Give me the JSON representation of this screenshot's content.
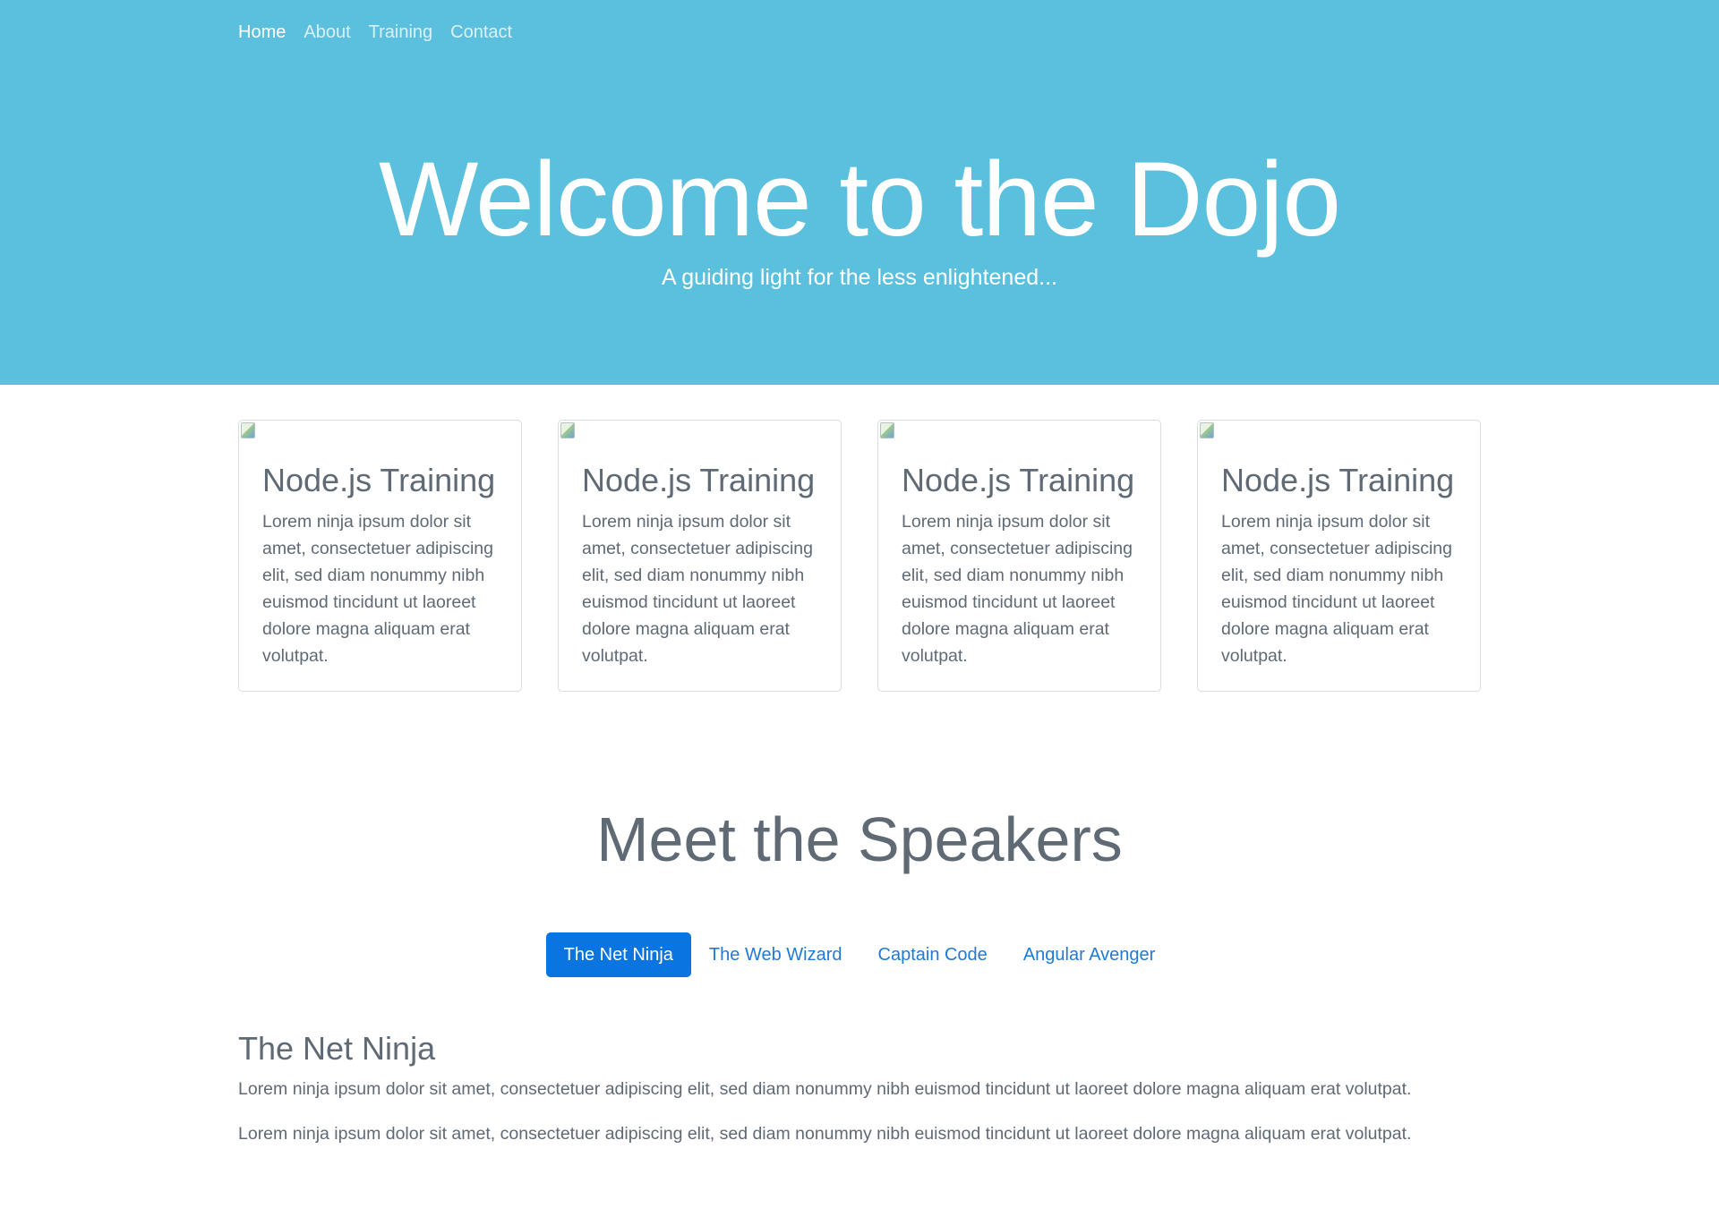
{
  "nav": {
    "items": [
      {
        "label": "Home",
        "active": true
      },
      {
        "label": "About",
        "active": false
      },
      {
        "label": "Training",
        "active": false
      },
      {
        "label": "Contact",
        "active": false
      }
    ]
  },
  "hero": {
    "title": "Welcome to the Dojo",
    "subtitle": "A guiding light for the less enlightened...",
    "background_color": "#5bc0de"
  },
  "cards": [
    {
      "title": "Node.js Training",
      "text": "Lorem ninja ipsum dolor sit amet, consectetuer adipiscing elit, sed diam nonummy nibh euismod tincidunt ut laoreet dolore magna aliquam erat volutpat.",
      "image_icon": "broken-image-icon"
    },
    {
      "title": "Node.js Training",
      "text": "Lorem ninja ipsum dolor sit amet, consectetuer adipiscing elit, sed diam nonummy nibh euismod tincidunt ut laoreet dolore magna aliquam erat volutpat.",
      "image_icon": "broken-image-icon"
    },
    {
      "title": "Node.js Training",
      "text": "Lorem ninja ipsum dolor sit amet, consectetuer adipiscing elit, sed diam nonummy nibh euismod tincidunt ut laoreet dolore magna aliquam erat volutpat.",
      "image_icon": "broken-image-icon"
    },
    {
      "title": "Node.js Training",
      "text": "Lorem ninja ipsum dolor sit amet, consectetuer adipiscing elit, sed diam nonummy nibh euismod tincidunt ut laoreet dolore magna aliquam erat volutpat.",
      "image_icon": "broken-image-icon"
    }
  ],
  "speakers": {
    "title": "Meet the Speakers",
    "tabs": [
      {
        "label": "The Net Ninja",
        "active": true
      },
      {
        "label": "The Web Wizard",
        "active": false
      },
      {
        "label": "Captain Code",
        "active": false
      },
      {
        "label": "Angular Avenger",
        "active": false
      }
    ],
    "active_content": {
      "heading": "The Net Ninja",
      "paragraphs": [
        "Lorem ninja ipsum dolor sit amet, consectetuer adipiscing elit, sed diam nonummy nibh euismod tincidunt ut laoreet dolore magna aliquam erat volutpat.",
        "Lorem ninja ipsum dolor sit amet, consectetuer adipiscing elit, sed diam nonummy nibh euismod tincidunt ut laoreet dolore magna aliquam erat volutpat."
      ]
    },
    "accent_color": "#0a74e1"
  }
}
